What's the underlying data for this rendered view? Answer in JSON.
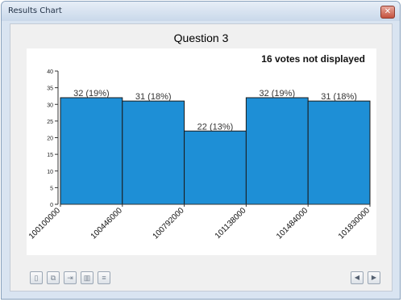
{
  "window": {
    "title": "Results Chart",
    "close_glyph": "✕"
  },
  "note": "16 votes not displayed",
  "toolbar": {
    "left_buttons": [
      {
        "name": "print-icon",
        "glyph": "▯"
      },
      {
        "name": "copy-chart-icon",
        "glyph": "⧉"
      },
      {
        "name": "export-icon",
        "glyph": "⇥"
      },
      {
        "name": "chart-type-icon",
        "glyph": "▥"
      },
      {
        "name": "options-icon",
        "glyph": "≡"
      }
    ],
    "prev_glyph": "◀",
    "next_glyph": "▶"
  },
  "chart_data": {
    "type": "bar",
    "title": "Question 3",
    "categories": [
      "100100000",
      "100446000",
      "100792000",
      "101138000",
      "101484000",
      "101830000"
    ],
    "values": [
      32,
      31,
      22,
      32,
      31
    ],
    "data_labels": [
      "32 (19%)",
      "31 (18%)",
      "22 (13%)",
      "32 (19%)",
      "31 (18%)"
    ],
    "ylim": [
      0,
      40
    ],
    "yticks": [
      0,
      5,
      10,
      15,
      20,
      25,
      30,
      35,
      40
    ],
    "grid": false,
    "colors": {
      "bar": "#1e8fd6",
      "bar_stroke": "#1a1a1a",
      "axis": "#333333"
    }
  }
}
